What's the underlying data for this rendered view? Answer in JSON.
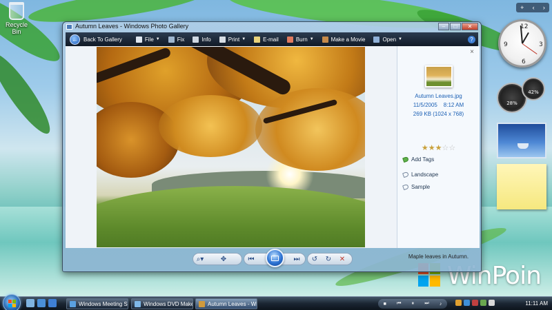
{
  "desktop": {
    "recycle_bin_label": "Recycle Bin",
    "watermark": "WinPoin"
  },
  "window": {
    "title": "Autumn Leaves - Windows Photo Gallery",
    "caption_buttons": {
      "minimize": "–",
      "maximize": "□",
      "close": "✕"
    }
  },
  "toolbar": {
    "back": "Back To Gallery",
    "items": [
      {
        "label": "File",
        "icon": "file-icon",
        "has_dropdown": true,
        "color": "#dfe7f0"
      },
      {
        "label": "Fix",
        "icon": "fix-icon",
        "has_dropdown": false,
        "color": "#9fb6cf"
      },
      {
        "label": "Info",
        "icon": "info-icon",
        "has_dropdown": false,
        "color": "#cfd8e3"
      },
      {
        "label": "Print",
        "icon": "print-icon",
        "has_dropdown": true,
        "color": "#d7dde4"
      },
      {
        "label": "E-mail",
        "icon": "email-icon",
        "has_dropdown": false,
        "color": "#e9d27a"
      },
      {
        "label": "Burn",
        "icon": "burn-icon",
        "has_dropdown": true,
        "color": "#e07a5f"
      },
      {
        "label": "Make a Movie",
        "icon": "movie-icon",
        "has_dropdown": false,
        "color": "#c58a4a"
      },
      {
        "label": "Open",
        "icon": "open-icon",
        "has_dropdown": true,
        "color": "#8fb0d8"
      }
    ],
    "help": "?"
  },
  "info_pane": {
    "close": "×",
    "filename": "Autumn Leaves.jpg",
    "date": "11/5/2005",
    "time": "8:12 AM",
    "size": "269 KB (1024 x 768)",
    "rating": 3,
    "rating_max": 5,
    "add_tags": "Add Tags",
    "tags": [
      "Landscape",
      "Sample"
    ],
    "caption": "Maple leaves in Autumn."
  },
  "controls": {
    "zoom": "zoom-icon",
    "actual_size": "actual-size-icon",
    "previous": "previous-icon",
    "slideshow": "slideshow-icon",
    "next": "next-icon",
    "rotate_ccw": "rotate-counterclockwise-icon",
    "rotate_cw": "rotate-clockwise-icon",
    "delete": "delete-icon"
  },
  "taskbar": {
    "buttons": [
      {
        "label": "Windows Meeting S...",
        "icon_color": "#5aa0e0",
        "active": false
      },
      {
        "label": "Windows DVD Maker",
        "icon_color": "#7fb8e8",
        "active": false
      },
      {
        "label": "Autumn Leaves - Wi...",
        "icon_color": "#d09a3c",
        "active": true
      }
    ],
    "clock": "11:11 AM"
  },
  "gadgets": {
    "cpu_percent": "28%",
    "mem_percent": "42%"
  },
  "colors": {
    "accent": "#1a5fb4",
    "toolbar_bg": "#111a26",
    "star_on": "#c9a13b",
    "star_off": "#bfbfbf"
  }
}
